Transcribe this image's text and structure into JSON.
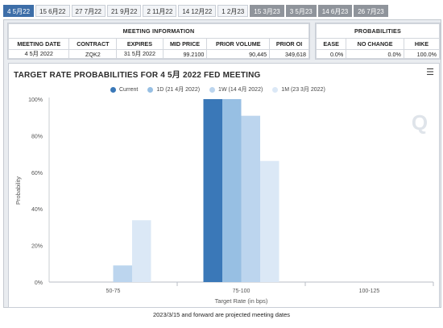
{
  "tabs": [
    {
      "label": "4 5月22",
      "state": "active"
    },
    {
      "label": "15 6月22",
      "state": ""
    },
    {
      "label": "27 7月22",
      "state": ""
    },
    {
      "label": "21 9月22",
      "state": ""
    },
    {
      "label": "2 11月22",
      "state": ""
    },
    {
      "label": "14 12月22",
      "state": ""
    },
    {
      "label": "1 2月23",
      "state": ""
    },
    {
      "label": "15 3月23",
      "state": "future"
    },
    {
      "label": "3 5月23",
      "state": "future"
    },
    {
      "label": "14 6月23",
      "state": "future"
    },
    {
      "label": "26 7月23",
      "state": "future"
    }
  ],
  "meeting_info": {
    "section_title": "MEETING INFORMATION",
    "headers": [
      "MEETING DATE",
      "CONTRACT",
      "EXPIRES",
      "MID PRICE",
      "PRIOR VOLUME",
      "PRIOR OI"
    ],
    "values": [
      "4 5月 2022",
      "ZQK2",
      "31 5月 2022",
      "99.2100",
      "90,445",
      "349,618"
    ]
  },
  "probabilities": {
    "section_title": "PROBABILITIES",
    "headers": [
      "EASE",
      "NO CHANGE",
      "HIKE"
    ],
    "values": [
      "0.0%",
      "0.0%",
      "100.0%"
    ]
  },
  "menu_icon": "hamburger-menu-icon",
  "watermark": "Q",
  "footer": "2023/3/15 and forward are projected meeting dates",
  "chart_data": {
    "type": "bar",
    "title": "TARGET RATE PROBABILITIES FOR 4 5月 2022 FED MEETING",
    "xlabel": "Target Rate (in bps)",
    "ylabel": "Probability",
    "categories": [
      "50-75",
      "75-100",
      "100-125"
    ],
    "ylim": [
      0,
      100
    ],
    "yticks": [
      "0%",
      "20%",
      "40%",
      "60%",
      "80%",
      "100%"
    ],
    "grid": false,
    "legend_position": "top",
    "series": [
      {
        "name": "Current",
        "color": "#3a78b8",
        "values": [
          0,
          100,
          0
        ]
      },
      {
        "name": "1D (21 4月 2022)",
        "color": "#97bfe3",
        "values": [
          0,
          100,
          0
        ]
      },
      {
        "name": "1W (14 4月 2022)",
        "color": "#bcd5ee",
        "values": [
          9.1,
          90.9,
          0
        ]
      },
      {
        "name": "1M (23 3月 2022)",
        "color": "#dbe8f6",
        "values": [
          33.8,
          66.2,
          0
        ]
      }
    ]
  }
}
